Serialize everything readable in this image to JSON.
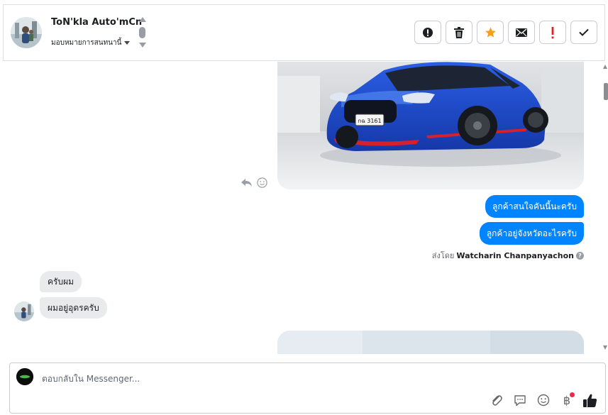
{
  "header": {
    "contact_name": "ToN'kla Auto'mCn",
    "assign_label": "มอบหมายการสนทนานี้"
  },
  "actions": [
    {
      "icon": "alert-circle-icon"
    },
    {
      "icon": "trash-icon"
    },
    {
      "icon": "star-icon",
      "color": "#f79e1b"
    },
    {
      "icon": "envelope-icon"
    },
    {
      "icon": "exclamation-icon",
      "color": "#e02020"
    },
    {
      "icon": "checkmark-icon"
    }
  ],
  "thread": {
    "car_photo_plate": "กฉ 3161",
    "outgoing": [
      {
        "text": "ลูกค้าสนใจคันนี้นะครับ"
      },
      {
        "text": "ลูกค้าอยู่จังหวัดอะไรครับ"
      }
    ],
    "sent_by_prefix": "ส่งโดย",
    "sent_by_name": "Watcharin Chanpanyachon",
    "help_mark": "?",
    "incoming": [
      {
        "text": "ครับผม"
      },
      {
        "text": "ผมอยู่อุดรครับ"
      }
    ]
  },
  "composer": {
    "placeholder": "ตอบกลับใน Messenger...",
    "tools": [
      "paperclip-icon",
      "saved-reply-icon",
      "emoji-icon",
      "payment-baht-icon",
      "thumbs-up-icon"
    ],
    "baht_symbol": "฿"
  },
  "colors": {
    "outgoing_bubble": "#0084ff",
    "incoming_bubble": "#e9eaec",
    "accent_star": "#f79e1b",
    "notification_dot": "#f02849"
  }
}
